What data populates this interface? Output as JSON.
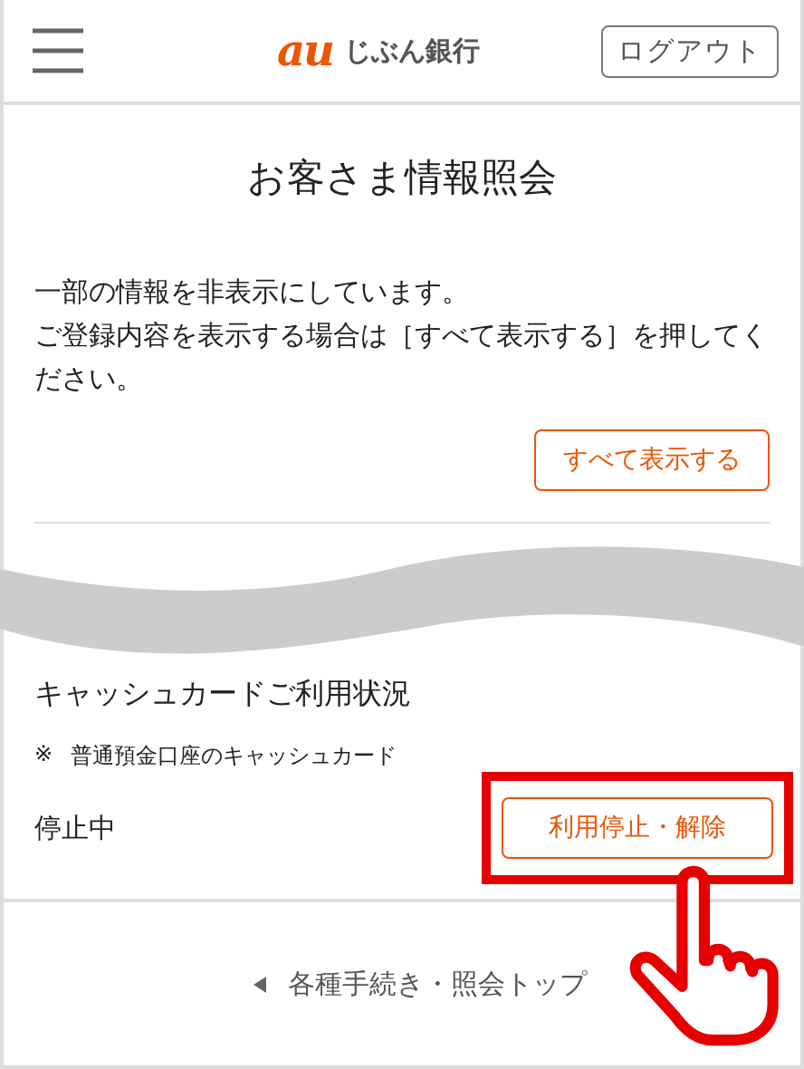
{
  "header": {
    "logo_mark": "au",
    "logo_text": "じぶん銀行",
    "logout_button": "ログアウト"
  },
  "info": {
    "title": "お客さま情報照会",
    "message": [
      "一部の情報を非表示にしています。",
      "ご登録内容を表示する場合は［すべて表示する］を押してください。"
    ],
    "show_all_button": "すべて表示する"
  },
  "card": {
    "title": "キャッシュカードご利用状況",
    "note_mark": "※",
    "note": "普通預金口座のキャッシュカード",
    "status": "停止中",
    "action_button": "利用停止・解除",
    "highlighted": true
  },
  "footer": {
    "link": "各種手続き・照会トップ"
  }
}
